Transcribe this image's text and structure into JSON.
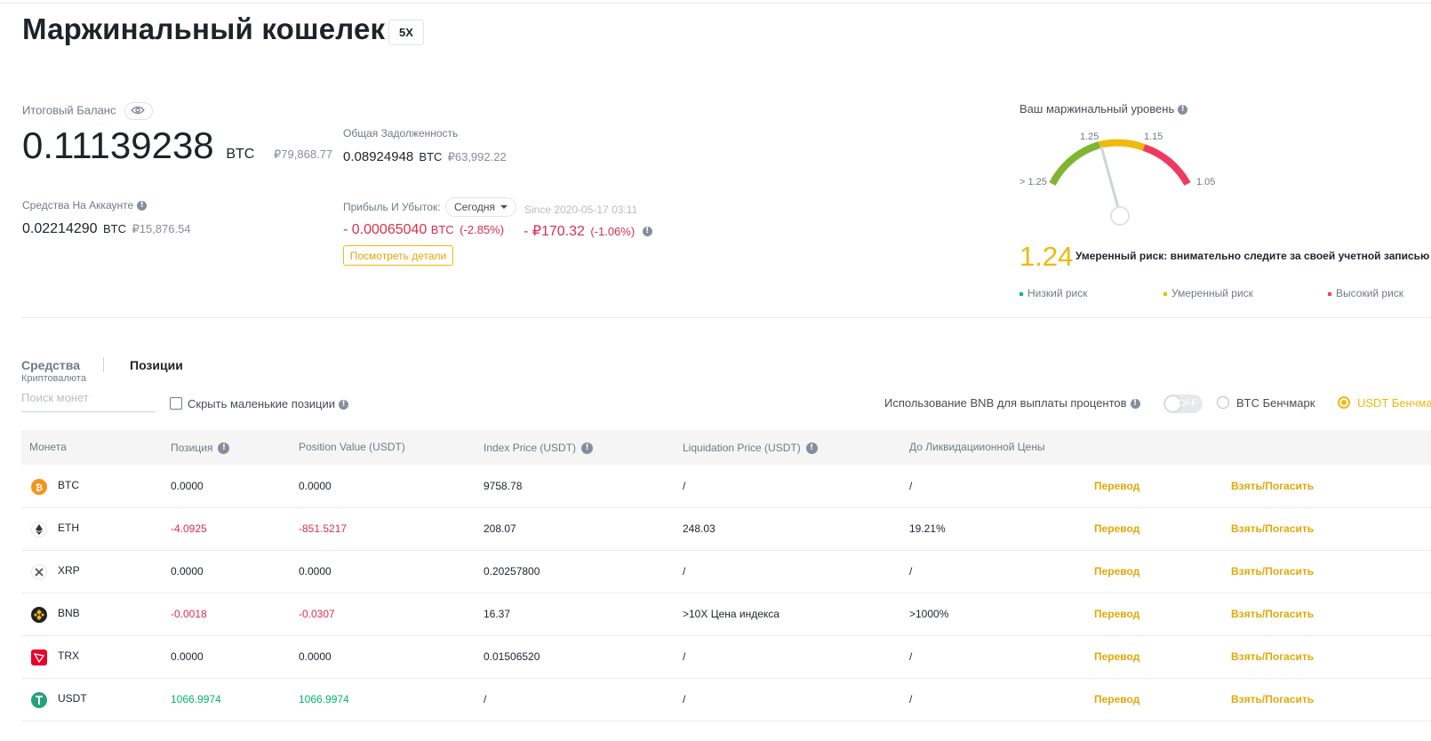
{
  "header": {
    "title": "Маржинальный кошелек",
    "leverage": "5X"
  },
  "balance": {
    "total_label": "Итоговый Баланс",
    "total_value": "0.11139238",
    "total_unit": "BTC",
    "total_fiat": "₽79,868.77",
    "account_label": "Средства На Аккаунте",
    "account_value": "0.02214290",
    "account_unit": "BTC",
    "account_fiat": "₽15,876.54"
  },
  "debt": {
    "label": "Общая Задолженность",
    "value": "0.08924948",
    "unit": "BTC",
    "fiat": "₽63,992.22"
  },
  "pnl": {
    "label": "Прибыль И Убыток:",
    "period": "Сегодня",
    "since": "Since 2020-05-17 03:11",
    "btc_value": "- 0.00065040",
    "btc_unit": "BTC",
    "btc_pct": "(-2.85%)",
    "fiat_value": "- ₽170.32",
    "fiat_pct": "(-1.06%)",
    "details_button": "Посмотреть детали"
  },
  "margin_level": {
    "label": "Ваш маржинальный уровень",
    "gauge_ticks": [
      "> 1.25",
      "1.25",
      "1.15",
      "1.05"
    ],
    "value": "1.24",
    "level_value": 1.24,
    "status_text": "Умеренный риск: внимательно следите за своей учетной записью",
    "legend": [
      {
        "label": "Низкий риск",
        "color": "#02c076"
      },
      {
        "label": "Умеренный риск",
        "color": "#f0b90b"
      },
      {
        "label": "Высокий риск",
        "color": "#f6465d"
      }
    ],
    "colors": {
      "low": "#7fb530",
      "moderate": "#f0b90b",
      "high": "#f0395f"
    }
  },
  "tabs": {
    "funds": "Средства",
    "funds_sub": "Криптовалюта",
    "positions": "Позиции"
  },
  "filters": {
    "search_placeholder": "Поиск монет",
    "hide_small": "Скрыть маленькие позиции",
    "bnb_label": "Использование BNB для выплаты процентов",
    "bnb_toggle": "OFF",
    "btc_benchmark": "BTC Бенчмарк",
    "usdt_benchmark": "USDT Бенчмарк"
  },
  "table": {
    "headers": [
      "Монета",
      "Позиция",
      "Position Value (USDT)",
      "Index Price (USDT)",
      "Liquidation Price (USDT)",
      "До Ликвидациионной Цены"
    ],
    "rows": [
      {
        "coin": "BTC",
        "icon": "bitcoin-icon",
        "position": "0.0000",
        "value": "0.0000",
        "index": "9758.78",
        "liq": "/",
        "to_liq": "/",
        "transfer": "Перевод",
        "borrow": "Взять/Погасить",
        "sign": "neutral"
      },
      {
        "coin": "ETH",
        "icon": "ethereum-icon",
        "position": "-4.0925",
        "value": "-851.5217",
        "index": "208.07",
        "liq": "248.03",
        "to_liq": "19.21%",
        "transfer": "Перевод",
        "borrow": "Взять/Погасить",
        "sign": "neg"
      },
      {
        "coin": "XRP",
        "icon": "xrp-icon",
        "position": "0.0000",
        "value": "0.0000",
        "index": "0.20257800",
        "liq": "/",
        "to_liq": "/",
        "transfer": "Перевод",
        "borrow": "Взять/Погасить",
        "sign": "neutral"
      },
      {
        "coin": "BNB",
        "icon": "bnb-icon",
        "position": "-0.0018",
        "value": "-0.0307",
        "index": "16.37",
        "liq": ">10X Цена индекса",
        "to_liq": ">1000%",
        "transfer": "Перевод",
        "borrow": "Взять/Погасить",
        "sign": "neg"
      },
      {
        "coin": "TRX",
        "icon": "tron-icon",
        "position": "0.0000",
        "value": "0.0000",
        "index": "0.01506520",
        "liq": "/",
        "to_liq": "/",
        "transfer": "Перевод",
        "borrow": "Взять/Погасить",
        "sign": "neutral"
      },
      {
        "coin": "USDT",
        "icon": "tether-icon",
        "position": "1066.9974",
        "value": "1066.9974",
        "index": "/",
        "liq": "/",
        "to_liq": "/",
        "transfer": "Перевод",
        "borrow": "Взять/Погасить",
        "sign": "pos"
      }
    ]
  }
}
